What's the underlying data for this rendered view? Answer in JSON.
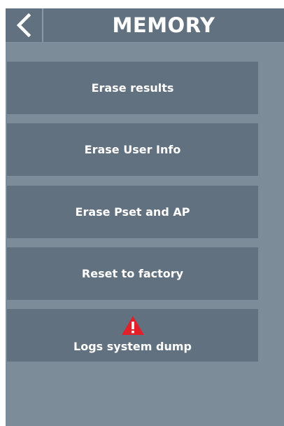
{
  "header": {
    "title": "MEMORY",
    "back_icon": "chevron-left-icon"
  },
  "buttons": [
    {
      "label": "Erase results"
    },
    {
      "label": "Erase User Info"
    },
    {
      "label": "Erase Pset and AP"
    },
    {
      "label": "Reset to factory"
    },
    {
      "label": "Logs system dump",
      "icon": "warning-icon"
    }
  ],
  "colors": {
    "background": "#7d8c99",
    "panel": "#627180",
    "text": "#ffffff",
    "warning": "#e3202a"
  }
}
